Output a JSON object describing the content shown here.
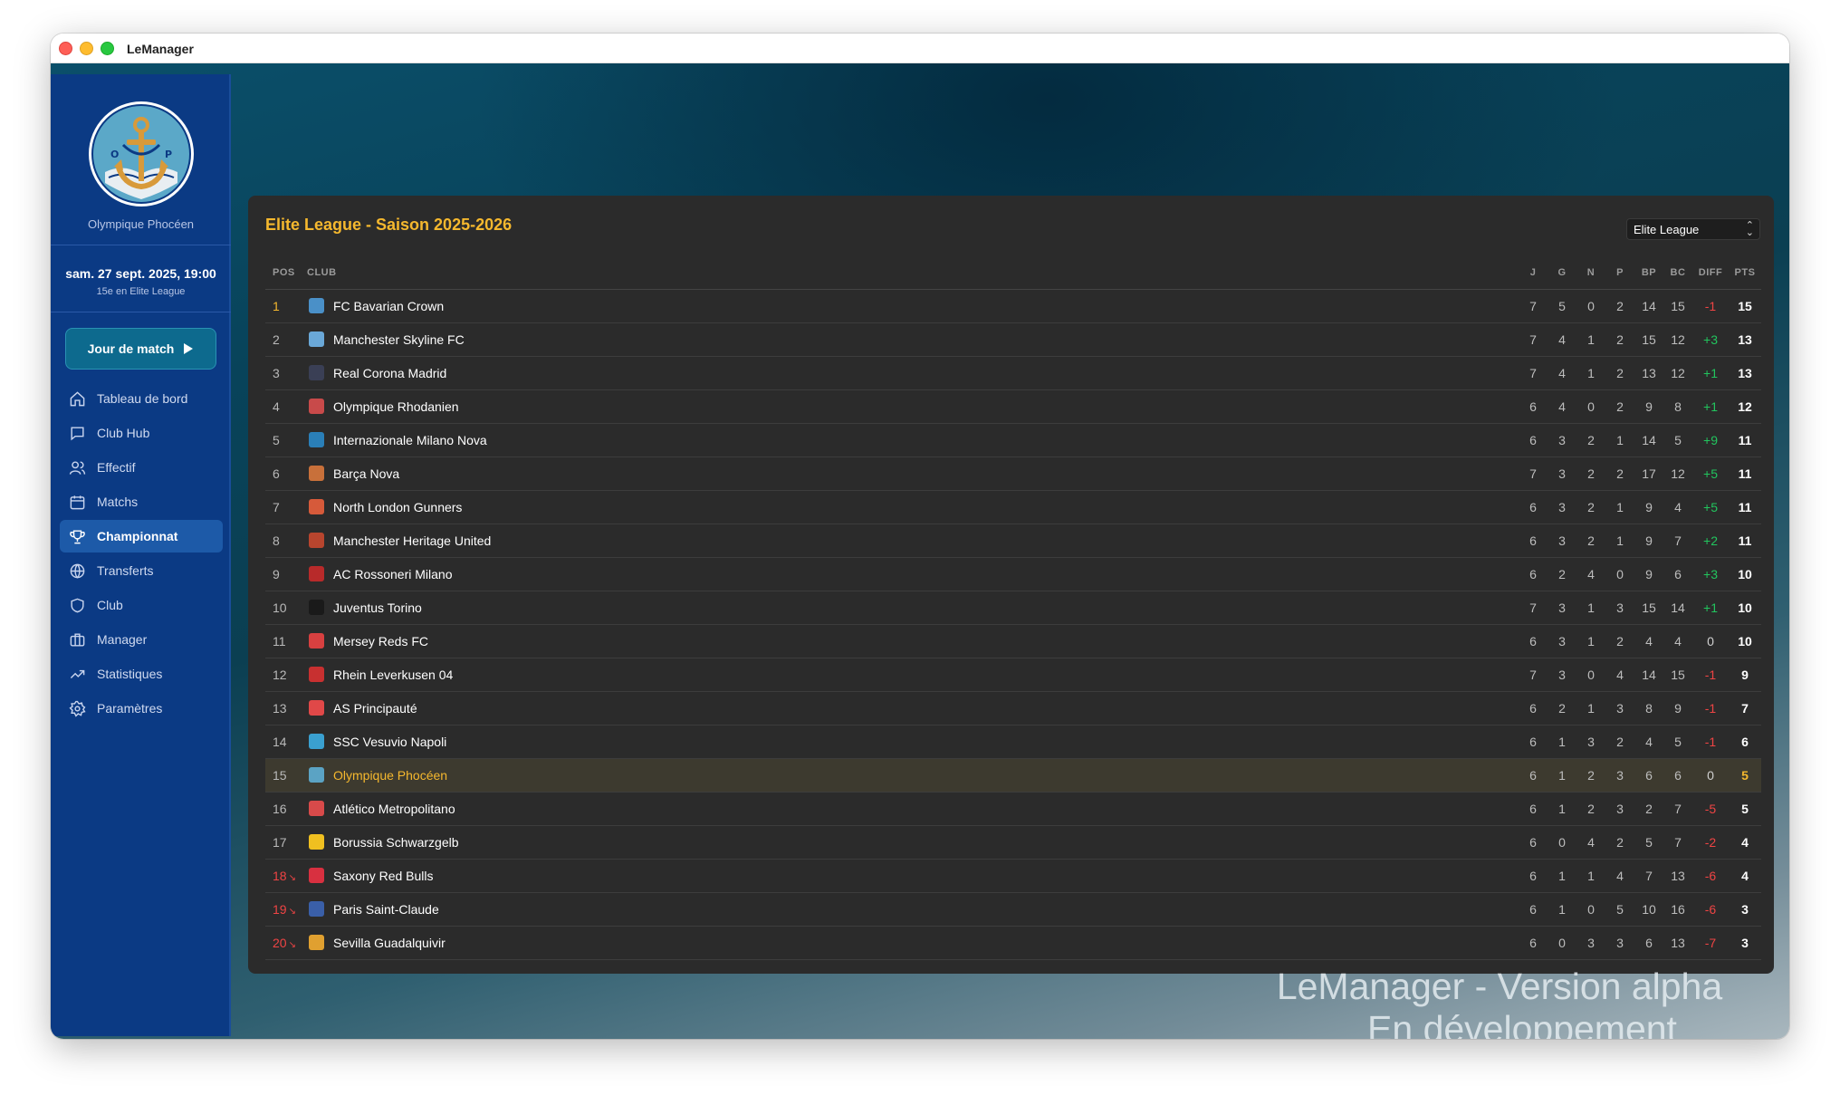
{
  "window": {
    "title": "LeManager"
  },
  "sidebar": {
    "club_name": "Olympique Phocéen",
    "date": "sam. 27 sept. 2025, 19:00",
    "rank": "15e en Elite League",
    "match_button": "Jour de match",
    "nav": [
      {
        "label": "Tableau de bord",
        "icon": "home-icon"
      },
      {
        "label": "Club Hub",
        "icon": "chat-icon"
      },
      {
        "label": "Effectif",
        "icon": "users-icon"
      },
      {
        "label": "Matchs",
        "icon": "calendar-icon"
      },
      {
        "label": "Championnat",
        "icon": "trophy-icon",
        "active": true
      },
      {
        "label": "Transferts",
        "icon": "globe-icon"
      },
      {
        "label": "Club",
        "icon": "shield-icon"
      },
      {
        "label": "Manager",
        "icon": "briefcase-icon"
      },
      {
        "label": "Statistiques",
        "icon": "trending-up-icon"
      },
      {
        "label": "Paramètres",
        "icon": "settings-icon"
      }
    ]
  },
  "standings": {
    "title": "Elite League - Saison 2025-2026",
    "selected_league": "Elite League",
    "columns": [
      "POS",
      "CLUB",
      "J",
      "G",
      "N",
      "P",
      "BP",
      "BC",
      "DIFF",
      "PTS"
    ],
    "rows": [
      {
        "pos": "1",
        "club": "FC Bavarian Crown",
        "j": "7",
        "g": "5",
        "n": "0",
        "p": "2",
        "bp": "14",
        "bc": "15",
        "diff": "-1",
        "pts": "15",
        "crest": "#4a90c8"
      },
      {
        "pos": "2",
        "club": "Manchester Skyline FC",
        "j": "7",
        "g": "4",
        "n": "1",
        "p": "2",
        "bp": "15",
        "bc": "12",
        "diff": "+3",
        "pts": "13",
        "crest": "#6aa8d8"
      },
      {
        "pos": "3",
        "club": "Real Corona Madrid",
        "j": "7",
        "g": "4",
        "n": "1",
        "p": "2",
        "bp": "13",
        "bc": "12",
        "diff": "+1",
        "pts": "13",
        "crest": "#3a3f55"
      },
      {
        "pos": "4",
        "club": "Olympique Rhodanien",
        "j": "6",
        "g": "4",
        "n": "0",
        "p": "2",
        "bp": "9",
        "bc": "8",
        "diff": "+1",
        "pts": "12",
        "crest": "#c84a4a"
      },
      {
        "pos": "5",
        "club": "Internazionale Milano Nova",
        "j": "6",
        "g": "3",
        "n": "2",
        "p": "1",
        "bp": "14",
        "bc": "5",
        "diff": "+9",
        "pts": "11",
        "crest": "#2a7fb8"
      },
      {
        "pos": "6",
        "club": "Barça Nova",
        "j": "7",
        "g": "3",
        "n": "2",
        "p": "2",
        "bp": "17",
        "bc": "12",
        "diff": "+5",
        "pts": "11",
        "crest": "#c8703a"
      },
      {
        "pos": "7",
        "club": "North London Gunners",
        "j": "6",
        "g": "3",
        "n": "2",
        "p": "1",
        "bp": "9",
        "bc": "4",
        "diff": "+5",
        "pts": "11",
        "crest": "#d65a3a"
      },
      {
        "pos": "8",
        "club": "Manchester Heritage United",
        "j": "6",
        "g": "3",
        "n": "2",
        "p": "1",
        "bp": "9",
        "bc": "7",
        "diff": "+2",
        "pts": "11",
        "crest": "#b8452e"
      },
      {
        "pos": "9",
        "club": "AC Rossoneri Milano",
        "j": "6",
        "g": "2",
        "n": "4",
        "p": "0",
        "bp": "9",
        "bc": "6",
        "diff": "+3",
        "pts": "10",
        "crest": "#b82a2a"
      },
      {
        "pos": "10",
        "club": "Juventus Torino",
        "j": "7",
        "g": "3",
        "n": "1",
        "p": "3",
        "bp": "15",
        "bc": "14",
        "diff": "+1",
        "pts": "10",
        "crest": "#1a1a1a"
      },
      {
        "pos": "11",
        "club": "Mersey Reds FC",
        "j": "6",
        "g": "3",
        "n": "1",
        "p": "2",
        "bp": "4",
        "bc": "4",
        "diff": "0",
        "pts": "10",
        "crest": "#d84040"
      },
      {
        "pos": "12",
        "club": "Rhein Leverkusen 04",
        "j": "7",
        "g": "3",
        "n": "0",
        "p": "4",
        "bp": "14",
        "bc": "15",
        "diff": "-1",
        "pts": "9",
        "crest": "#c83030"
      },
      {
        "pos": "13",
        "club": "AS Principauté",
        "j": "6",
        "g": "2",
        "n": "1",
        "p": "3",
        "bp": "8",
        "bc": "9",
        "diff": "-1",
        "pts": "7",
        "crest": "#e04848"
      },
      {
        "pos": "14",
        "club": "SSC Vesuvio Napoli",
        "j": "6",
        "g": "1",
        "n": "3",
        "p": "2",
        "bp": "4",
        "bc": "5",
        "diff": "-1",
        "pts": "6",
        "crest": "#3aa0d0"
      },
      {
        "pos": "15",
        "club": "Olympique Phocéen",
        "j": "6",
        "g": "1",
        "n": "2",
        "p": "3",
        "bp": "6",
        "bc": "6",
        "diff": "0",
        "pts": "5",
        "crest": "#5ba3c4",
        "highlight": true
      },
      {
        "pos": "16",
        "club": "Atlético Metropolitano",
        "j": "6",
        "g": "1",
        "n": "2",
        "p": "3",
        "bp": "2",
        "bc": "7",
        "diff": "-5",
        "pts": "5",
        "crest": "#d84a4a"
      },
      {
        "pos": "17",
        "club": "Borussia Schwarzgelb",
        "j": "6",
        "g": "0",
        "n": "4",
        "p": "2",
        "bp": "5",
        "bc": "7",
        "diff": "-2",
        "pts": "4",
        "crest": "#f0c020"
      },
      {
        "pos": "18",
        "club": "Saxony Red Bulls",
        "j": "6",
        "g": "1",
        "n": "1",
        "p": "4",
        "bp": "7",
        "bc": "13",
        "diff": "-6",
        "pts": "4",
        "crest": "#d83040",
        "relegation": true
      },
      {
        "pos": "19",
        "club": "Paris Saint-Claude",
        "j": "6",
        "g": "1",
        "n": "0",
        "p": "5",
        "bp": "10",
        "bc": "16",
        "diff": "-6",
        "pts": "3",
        "crest": "#3a5fa8",
        "relegation": true
      },
      {
        "pos": "20",
        "club": "Sevilla Guadalquivir",
        "j": "6",
        "g": "0",
        "n": "3",
        "p": "3",
        "bp": "6",
        "bc": "13",
        "diff": "-7",
        "pts": "3",
        "crest": "#e0a030",
        "relegation": true
      }
    ]
  },
  "watermark": {
    "line1": "LeManager - Version alpha",
    "line2": "En développement"
  },
  "colors": {
    "accent": "#f5b82e",
    "positive": "#22c55e",
    "negative": "#ef4444",
    "sidebar": "#0b3a84"
  }
}
